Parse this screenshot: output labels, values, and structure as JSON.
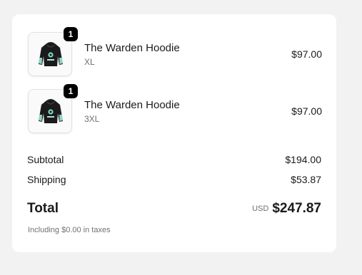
{
  "cart": {
    "items": [
      {
        "name": "The Warden Hoodie",
        "variant": "XL",
        "price": "$97.00",
        "quantity": "1",
        "image": "hoodie-thumbnail"
      },
      {
        "name": "The Warden Hoodie",
        "variant": "3XL",
        "price": "$97.00",
        "quantity": "1",
        "image": "hoodie-thumbnail"
      }
    ]
  },
  "summary": {
    "subtotal_label": "Subtotal",
    "subtotal_value": "$194.00",
    "shipping_label": "Shipping",
    "shipping_value": "$53.87",
    "total_label": "Total",
    "currency": "USD",
    "total_value": "$247.87",
    "taxes_note": "Including $0.00 in taxes"
  },
  "colors": {
    "page_background": "#f2f2f2",
    "card_background": "#ffffff",
    "badge_background": "#000000",
    "muted_text": "#707070"
  }
}
